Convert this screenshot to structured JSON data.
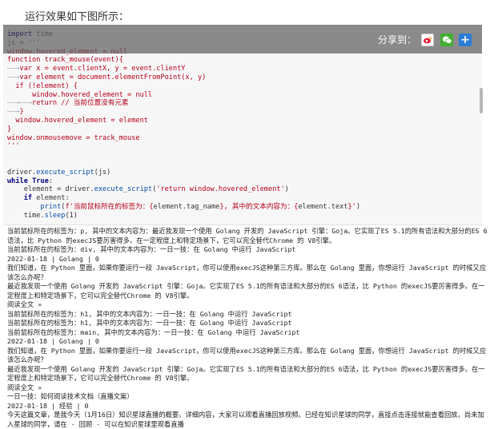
{
  "intro": "运行效果如下图所示：",
  "share": {
    "label": "分享到：",
    "icons": [
      "weibo-icon",
      "wechat-icon",
      "more-icon"
    ],
    "bar_color": "#5f5f5f",
    "wechat_color": "#42b031",
    "more_color": "#2a7dd6"
  },
  "code": [
    [
      [
        "k",
        "import"
      ],
      [
        "n",
        " time"
      ]
    ],
    [
      [
        "n",
        "js = "
      ],
      [
        "s",
        "'''"
      ]
    ],
    [
      [
        "s",
        "window.hovered_element = null"
      ]
    ],
    [
      [
        "s",
        "function track_mouse(event){"
      ]
    ],
    [
      [
        "m",
        "——→"
      ],
      [
        "s",
        "var x = event.clientX, y = event.clientY"
      ]
    ],
    [
      [
        "m",
        "——→"
      ],
      [
        "s",
        "var element = document.elementFromPoint(x, y)"
      ]
    ],
    [
      [
        "s",
        "  if (!element) {"
      ]
    ],
    [
      [
        "s",
        "      window.hovered_element = null"
      ]
    ],
    [
      [
        "m",
        "——→——→"
      ],
      [
        "s",
        "return // 当前位置没有元素"
      ]
    ],
    [
      [
        "m",
        "——→"
      ],
      [
        "s",
        "}"
      ]
    ],
    [
      [
        "s",
        "  window.hovered_element = element"
      ]
    ],
    [
      [
        "s",
        "}"
      ]
    ],
    [
      [
        "s",
        "window.onmousemove = track_mouse"
      ]
    ],
    [
      [
        "s",
        "'''"
      ]
    ],
    [],
    [],
    [
      [
        "n",
        "driver."
      ],
      [
        "f",
        "execute_script"
      ],
      [
        "n",
        "(js)"
      ]
    ],
    [
      [
        "k",
        "while"
      ],
      [
        "n",
        " "
      ],
      [
        "k",
        "True"
      ],
      [
        "n",
        ":"
      ]
    ],
    [
      [
        "n",
        "    element = driver."
      ],
      [
        "f",
        "execute_script"
      ],
      [
        "n",
        "("
      ],
      [
        "s",
        "'return window.hovered_element'"
      ],
      [
        "n",
        ")"
      ]
    ],
    [
      [
        "n",
        "    "
      ],
      [
        "k",
        "if"
      ],
      [
        "n",
        " element:"
      ]
    ],
    [
      [
        "n",
        "        "
      ],
      [
        "f",
        "print"
      ],
      [
        "n",
        "("
      ],
      [
        "s",
        "f'当前鼠标所在的标签为：{"
      ],
      [
        "n",
        "element.tag_name"
      ],
      [
        "s",
        "}, 其中的文本内容为：{"
      ],
      [
        "n",
        "element.text"
      ],
      [
        "s",
        "}'"
      ],
      [
        "n",
        ")"
      ]
    ],
    [
      [
        "n",
        "    time."
      ],
      [
        "f",
        "sleep"
      ],
      [
        "n",
        "(1)"
      ]
    ]
  ],
  "output": [
    "当前鼠标所在的标签为：p, 其中的文本内容为：最近我发现一个使用 Golang 开发的 JavaScript 引擎：Goja。它实现了ES 5.1的所有语法和大部分的ES 6语法，比 Python 的execJS要厉害得多。在一定程度上和特定场景下，它可以完全替代Chrome 的 V8引擎。",
    "当前鼠标所在的标签为：div, 其中的文本内容为：一日一技：在 Golang 中运行 JavaScript",
    "2022-01-18 | Golang | 0",
    "我们知道，在 Python 里面，如果你要运行一段 JavaScript，你可以使用execJS这种第三方库。那么在 Golang 里面，你想运行 JavaScript 的时候又应该怎么办呢？",
    "最近我发现一个使用 Golang 开发的 JavaScript 引擎：Goja。它实现了ES 5.1的所有语法和大部分的ES 6语法，比 Python 的execJS要厉害得多。在一定程度上和特定场景下，它可以完全替代Chrome 的 V8引擎。",
    "阅读全文 »",
    "当前鼠标所在的标签为：h1, 其中的文本内容为：一日一技：在 Golang 中运行 JavaScript",
    "当前鼠标所在的标签为：h1, 其中的文本内容为：一日一技：在 Golang 中运行 JavaScript",
    "当前鼠标所在的标签为：main, 其中的文本内容为：一日一技：在 Golang 中运行 JavaScript",
    "2022-01-18 | Golang | 0",
    "我们知道，在 Python 里面，如果你要运行一段 JavaScript，你可以使用execJS这种第三方库。那么在 Golang 里面，你想运行 JavaScript 的时候又应该怎么办呢？",
    "最近我发现一个使用 Golang 开发的 JavaScript 引擎：Goja。它实现了ES 5.1的所有语法和大部分的ES 6语法，比 Python 的execJS要厉害得多。在一定程度上和特定场景下，它可以完全替代Chrome 的 V8引擎。",
    "阅读全文 »",
    "一日一技：如何阅读技术文档（直播文案）",
    "2022-01-18 | 经验 | 0",
    "今天这篇文章，是我今天（1月16日）知识星球直播的概要。详细内容，大家可以观看直播回放视频。已经在知识星球的同学，直接点击连接就能查看回放。尚未加入星球的同学，请在 · 回顾 · 可以在知识星球里观看直播"
  ]
}
